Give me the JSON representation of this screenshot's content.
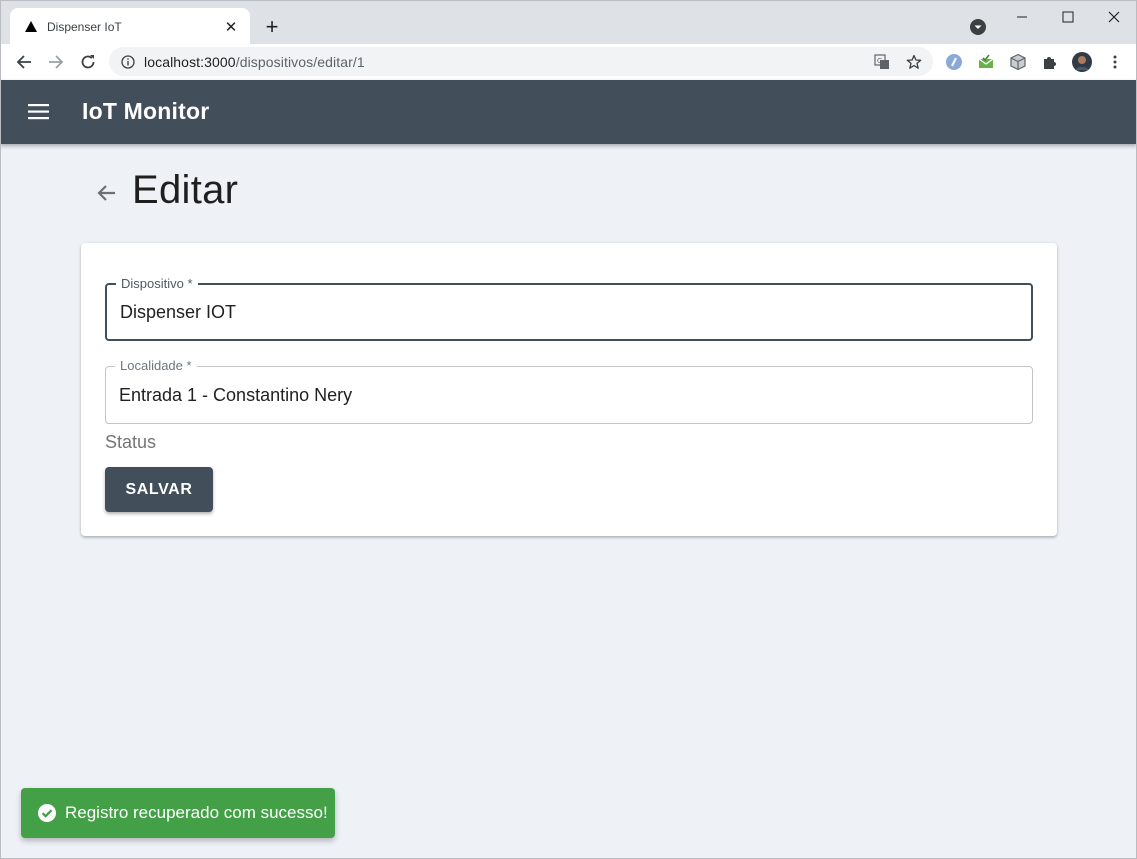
{
  "browser": {
    "tab_title": "Dispenser IoT",
    "url_host": "localhost:3000",
    "url_path": "/dispositivos/editar/1"
  },
  "app": {
    "title": "IoT Monitor"
  },
  "page": {
    "title": "Editar"
  },
  "form": {
    "dispositivo_label": "Dispositivo *",
    "dispositivo_value": "Dispenser IOT",
    "localidade_label": "Localidade *",
    "localidade_value": "Entrada 1 - Constantino Nery",
    "status_label": "Status",
    "save_label": "SALVAR"
  },
  "snackbar": {
    "message": "Registro recuperado com sucesso!"
  },
  "colors": {
    "appbar": "#424e5a",
    "success": "#43a047",
    "background": "#eef2f7"
  }
}
